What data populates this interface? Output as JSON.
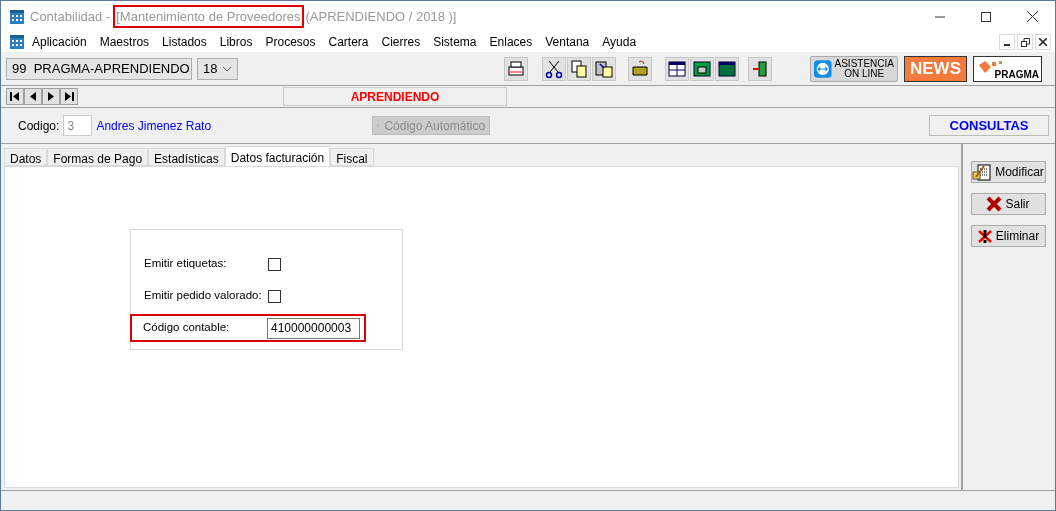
{
  "window": {
    "title_prefix": "Contabilidad -",
    "title_main": "[Mantenimiento de Proveedores",
    "title_main_highlighted": true,
    "title_suffix": "(APRENDIENDO / 2018 )]"
  },
  "menu": [
    "Aplicación",
    "Maestros",
    "Listados",
    "Libros",
    "Procesos",
    "Cartera",
    "Cierres",
    "Sistema",
    "Enlaces",
    "Ventana",
    "Ayuda"
  ],
  "toolbar": {
    "company": "99  PRAGMA-APRENDIENDO",
    "year": "18",
    "support_label": [
      "ASISTENCIA",
      "ON LINE"
    ],
    "news": "NEWS",
    "brand": "PRAGMA"
  },
  "nav": {
    "banner": "APRENDIENDO"
  },
  "record": {
    "code_label": "Codigo:",
    "code": "3",
    "name": "Andres Jimenez Rato",
    "auto_code_button": "Código Automático",
    "auto_code_disabled": true,
    "consult_button": "CONSULTAS"
  },
  "tabs": [
    {
      "label": "Datos",
      "selected": false
    },
    {
      "label": "Formas de Pago",
      "selected": false
    },
    {
      "label": "Estadísticas",
      "selected": false
    },
    {
      "label": "Datos facturación",
      "selected": true
    },
    {
      "label": "Fiscal",
      "selected": false
    }
  ],
  "form": [
    {
      "kind": "checkbox",
      "label": "Emitir etiquetas:",
      "checked": false,
      "highlighted": false
    },
    {
      "kind": "checkbox",
      "label": "Emitir pedido valorado:",
      "checked": false,
      "highlighted": false
    },
    {
      "kind": "text",
      "label": "Código contable:",
      "value": "410000000003",
      "highlighted": true
    }
  ],
  "actions": [
    {
      "kind": "edit",
      "label": "Modificar"
    },
    {
      "kind": "exit",
      "label": "Salir"
    },
    {
      "kind": "delete",
      "label": "Eliminar"
    }
  ]
}
